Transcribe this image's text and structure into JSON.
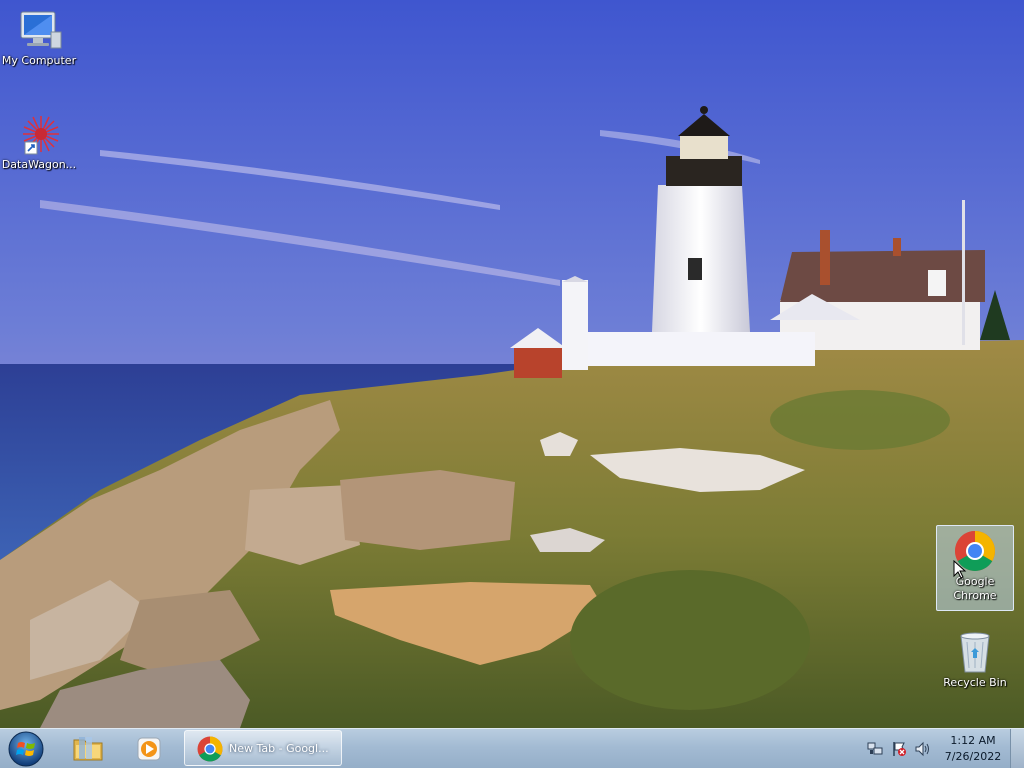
{
  "desktop": {
    "icons": [
      {
        "label": "My Computer",
        "icon": "computer-icon"
      },
      {
        "label": "DataWagon...",
        "icon": "datawagon-shortcut-icon"
      },
      {
        "label": "Google Chrome",
        "label_lines": [
          "Google",
          "Chrome"
        ],
        "icon": "chrome-icon",
        "selected": true
      },
      {
        "label": "Recycle Bin",
        "icon": "recycle-bin-icon"
      }
    ]
  },
  "taskbar": {
    "start_icon": "windows-start-orb-icon",
    "pinned": [
      {
        "icon": "file-explorer-icon"
      },
      {
        "icon": "media-player-icon"
      }
    ],
    "tasks": [
      {
        "label": "New Tab - Googl...",
        "icon": "chrome-icon",
        "active": true
      }
    ],
    "tray": [
      {
        "icon": "network-icon"
      },
      {
        "icon": "action-center-flag-icon"
      },
      {
        "icon": "volume-icon"
      }
    ],
    "clock": {
      "time": "1:12 AM",
      "date": "7/26/2022"
    }
  },
  "colors": {
    "sky_top": "#4a5fd0",
    "sky_bottom": "#b7a3d6",
    "sea": "#2b4a9c",
    "grass": "#8a8a3a",
    "taskbar": "#a3bbd3"
  }
}
